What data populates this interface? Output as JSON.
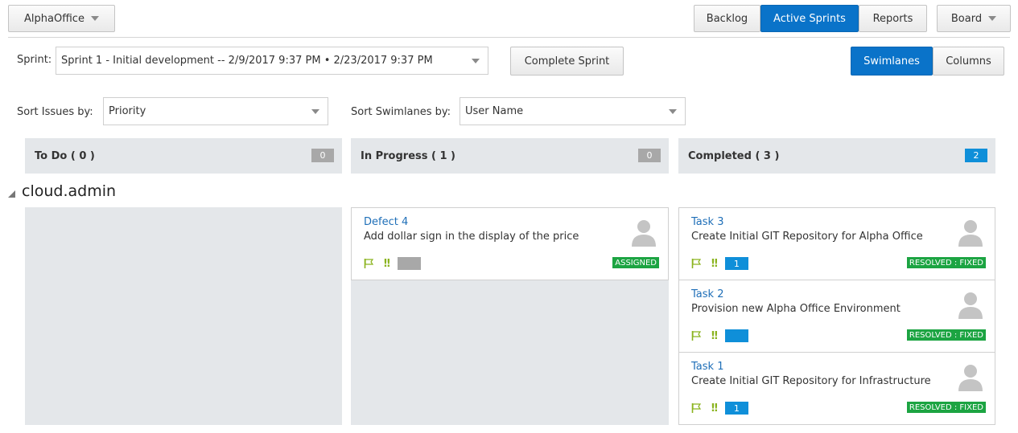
{
  "header": {
    "project": "AlphaOffice",
    "nav": {
      "backlog": "Backlog",
      "active_sprints": "Active Sprints",
      "reports": "Reports",
      "board": "Board"
    }
  },
  "sprint": {
    "label": "Sprint:",
    "value": "Sprint 1 - Initial development -- 2/9/2017 9:37 PM • 2/23/2017 9:37 PM",
    "complete_button": "Complete Sprint"
  },
  "view_toggle": {
    "swimlanes": "Swimlanes",
    "columns": "Columns"
  },
  "sort": {
    "issues_label": "Sort Issues by:",
    "issues_value": "Priority",
    "swimlanes_label": "Sort Swimlanes by:",
    "swimlanes_value": "User Name"
  },
  "columns": [
    {
      "title": "To Do ( 0 )",
      "count": "0"
    },
    {
      "title": "In Progress ( 1 )",
      "count": "0"
    },
    {
      "title": "Completed ( 3 )",
      "count": "2"
    }
  ],
  "swimlane": {
    "name": "cloud.admin"
  },
  "cards": {
    "in_progress": [
      {
        "id": "Defect 4",
        "summary": "Add dollar sign in the display of the price",
        "points": "",
        "status": "ASSIGNED"
      }
    ],
    "completed": [
      {
        "id": "Task 3",
        "summary": "Create Initial GIT Repository for Alpha Office",
        "points": "1",
        "status": "RESOLVED : FIXED"
      },
      {
        "id": "Task 2",
        "summary": "Provision new Alpha Office Environment",
        "points": "",
        "status": "RESOLVED : FIXED"
      },
      {
        "id": "Task 1",
        "summary": "Create Initial GIT Repository for Infrastructure",
        "points": "1",
        "status": "RESOLVED : FIXED"
      }
    ]
  },
  "colors": {
    "accent": "#0a73c9",
    "badge_blue": "#0f8fd9",
    "status_green": "#1ca442",
    "priority_green": "#8ab31e",
    "column_bg": "#e4e7ea"
  },
  "icons": {
    "flag": "flag-icon",
    "priority": "priority-icon",
    "avatar": "user-avatar-icon",
    "dropdown": "chevron-down-icon"
  }
}
